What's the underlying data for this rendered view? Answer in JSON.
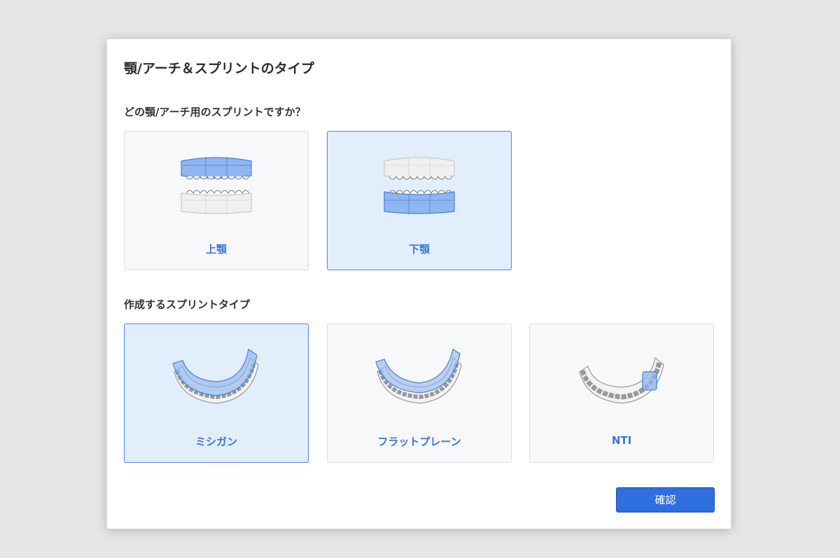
{
  "dialog": {
    "title": "顎/アーチ＆スプリントのタイプ",
    "jaw_question": "どの顎/アーチ用のスプリントですか？",
    "jaw_options": [
      {
        "label": "上顎",
        "selected": false,
        "icon": "upper-jaw-splint-icon"
      },
      {
        "label": "下顎",
        "selected": true,
        "icon": "lower-jaw-splint-icon"
      }
    ],
    "type_question": "作成するスプリントタイプ",
    "type_options": [
      {
        "label": "ミシガン",
        "selected": true,
        "icon": "michigan-splint-icon"
      },
      {
        "label": "フラットプレーン",
        "selected": false,
        "icon": "flat-plane-splint-icon"
      },
      {
        "label": "NTI",
        "selected": false,
        "icon": "nti-splint-icon"
      }
    ],
    "confirm_label": "確認"
  },
  "colors": {
    "accent": "#2f6fe0",
    "selected_bg": "#e2eefc",
    "label_blue": "#3a77d8",
    "splint_blue": "#8fb6f0"
  }
}
